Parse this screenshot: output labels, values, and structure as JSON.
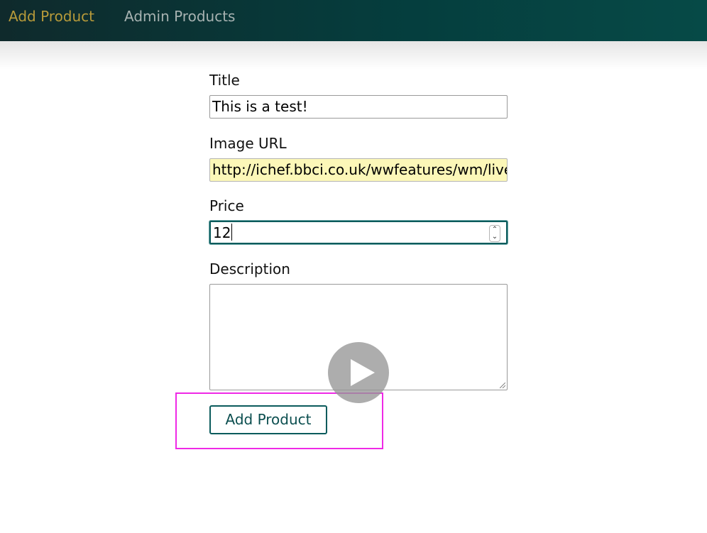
{
  "nav": {
    "items": [
      {
        "label": "Add Product",
        "active": true
      },
      {
        "label": "Admin Products",
        "active": false
      }
    ]
  },
  "form": {
    "title": {
      "label": "Title",
      "value": "This is a test!"
    },
    "image_url": {
      "label": "Image URL",
      "value": "http://ichef.bbci.co.uk/wwfeatures/wm/live"
    },
    "price": {
      "label": "Price",
      "value": "12"
    },
    "description": {
      "label": "Description",
      "value": ""
    },
    "submit_label": "Add Product"
  },
  "overlay": {
    "icon": "play-icon"
  },
  "colors": {
    "nav_bg": "#053d3d",
    "nav_active": "#b79a3a",
    "nav_inactive": "#a7b2b1",
    "accent": "#0b5b5c",
    "autofill_bg": "#fcf7b8",
    "highlight": "#ef29e6"
  }
}
